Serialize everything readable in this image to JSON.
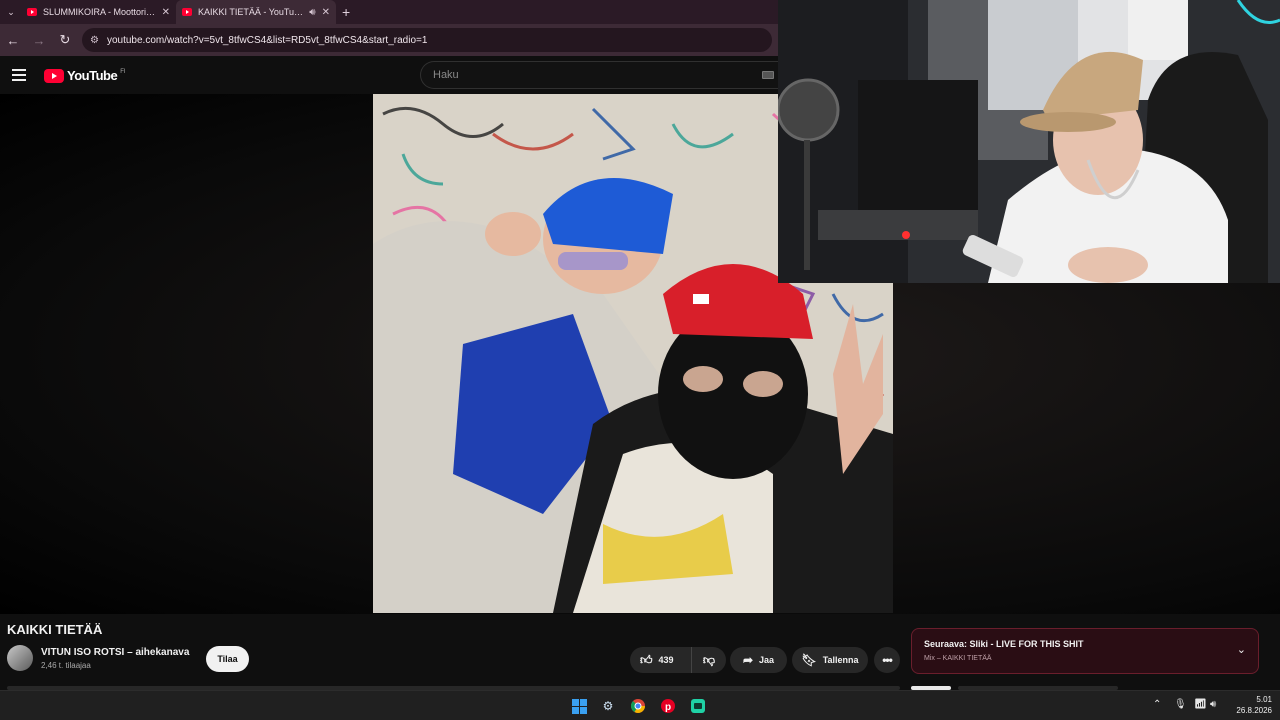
{
  "browser": {
    "tabs": [
      {
        "title": "SLUMMIKOIRA - Moottorijuma",
        "active": false
      },
      {
        "title": "KAIKKI TIETÄÄ - YouTube",
        "active": true
      }
    ],
    "url": "youtube.com/watch?v=5vt_8tfwCS4&list=RD5vt_8tfwCS4&start_radio=1",
    "new_tab_label": "+"
  },
  "youtube": {
    "logo_text": "YouTube",
    "region": "FI",
    "search_placeholder": "Haku",
    "video": {
      "title": "KAIKKI TIETÄÄ",
      "channel": "VITUN ISO ROTSI – aihekanava",
      "subscribers": "2,46 t. tilaajaa",
      "subscribe_label": "Tilaa",
      "likes": "439",
      "share_label": "Jaa",
      "save_label": "Tallenna",
      "more_label": "•••"
    },
    "up_next": {
      "title": "Seuraava: Sliki - LIVE FOR THIS SHIT",
      "subtitle": "Mix – KAIKKI TIETÄÄ"
    }
  },
  "taskbar": {
    "time": "5.01",
    "date": "26.8.2026"
  },
  "colors": {
    "youtube_red": "#ff0033",
    "tab_bar": "#2b1a26",
    "up_next_border": "#6a1e2c"
  }
}
